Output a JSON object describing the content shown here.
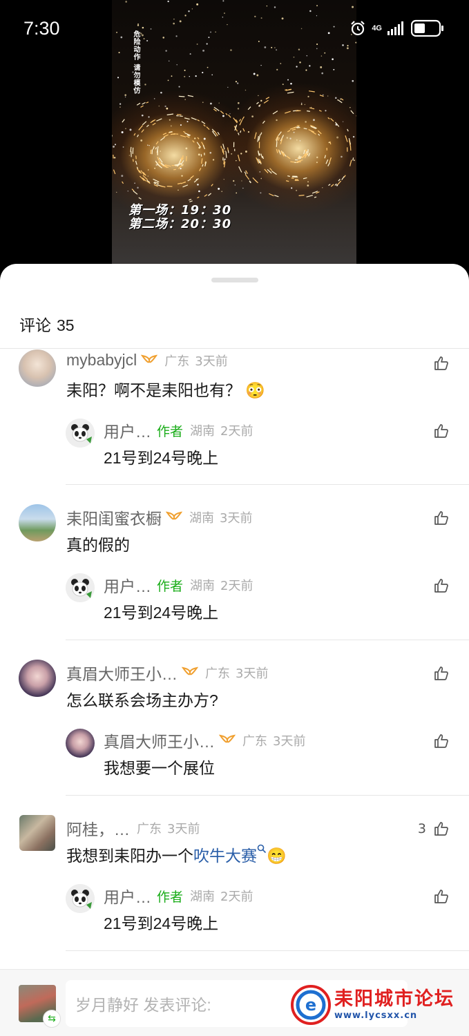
{
  "status_bar": {
    "time": "7:30",
    "network": "4G"
  },
  "video": {
    "warning_text": "危险动作 请勿模仿",
    "show_time_1": "第一场：19：30",
    "show_time_2": "第二场：20：30"
  },
  "comments_header": {
    "label": "评论",
    "count": "35"
  },
  "threads": [
    {
      "comment": {
        "name": "mybabyjcl",
        "vip": true,
        "location": "广东",
        "time": "3天前",
        "text": "耒阳？啊不是耒阳也有？",
        "emoji": "😳",
        "likes": ""
      },
      "reply": {
        "name": "用户…",
        "tag": "作者",
        "location": "湖南",
        "time": "2天前",
        "text": "21号到24号晚上"
      }
    },
    {
      "comment": {
        "name": "耒阳闺蜜衣橱",
        "vip": true,
        "location": "湖南",
        "time": "3天前",
        "text": "真的假的",
        "likes": ""
      },
      "reply": {
        "name": "用户…",
        "tag": "作者",
        "location": "湖南",
        "time": "2天前",
        "text": "21号到24号晚上"
      }
    },
    {
      "comment": {
        "name": "真眉大师王小…",
        "vip": true,
        "location": "广东",
        "time": "3天前",
        "text": "怎么联系会场主办方?",
        "likes": ""
      },
      "reply": {
        "name": "真眉大师王小…",
        "vip": true,
        "location": "广东",
        "time": "3天前",
        "text": "我想要一个展位"
      }
    },
    {
      "comment": {
        "name": "阿桂，…",
        "location": "广东",
        "time": "3天前",
        "text_before": "我想到耒阳办一个",
        "link_text": "吹牛大赛",
        "emoji": "😁",
        "likes": "3"
      },
      "reply": {
        "name": "用户…",
        "tag": "作者",
        "location": "湖南",
        "time": "2天前",
        "text": "21号到24号晚上"
      }
    }
  ],
  "input": {
    "placeholder": "岁月静好 发表评论:"
  },
  "watermark": {
    "title": "耒阳城市论坛",
    "url": "www.lycsxx.cn"
  },
  "colors": {
    "author_tag": "#1aad19",
    "link": "#2a5ea8",
    "vip_badge": "#f0a030"
  }
}
